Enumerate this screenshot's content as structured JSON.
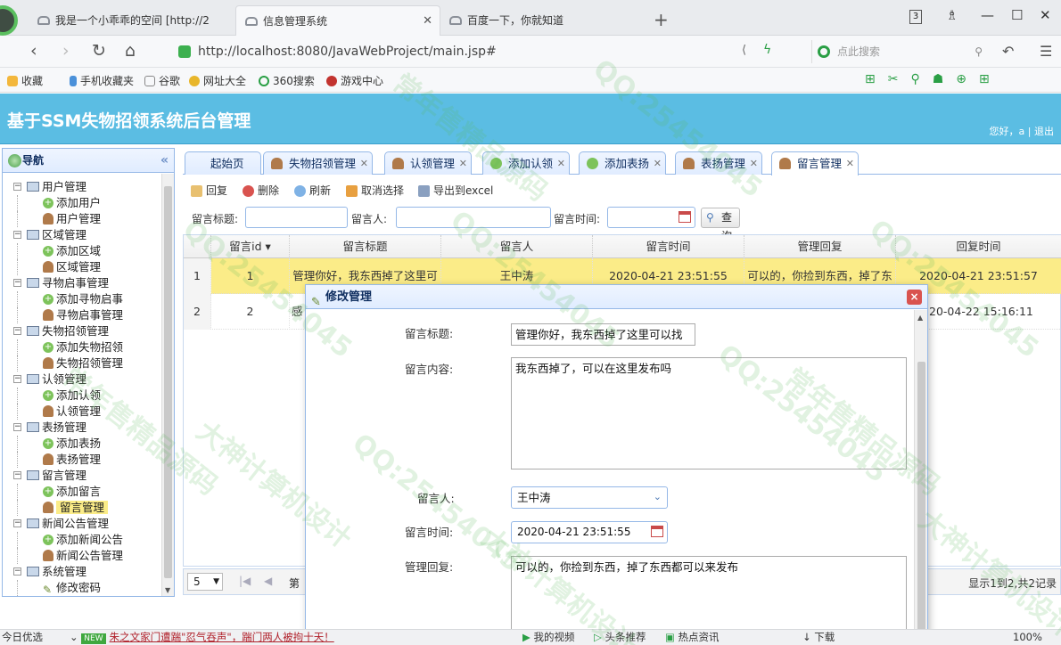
{
  "browser": {
    "tabs": [
      {
        "label": "我是一个小乖乖的空间 [http://2",
        "active": false
      },
      {
        "label": "信息管理系统",
        "active": true
      },
      {
        "label": "百度一下，你就知道",
        "active": false
      }
    ],
    "tab_count": "3",
    "url": "http://localhost:8080/JavaWebProject/main.jsp#",
    "search_placeholder": "点此搜索",
    "bookmarks": [
      "收藏",
      "手机收藏夹",
      "谷歌",
      "网址大全",
      "360搜索",
      "游戏中心"
    ],
    "zoom": "100%"
  },
  "app": {
    "title": "基于SSM失物招领系统后台管理",
    "user_greeting": "您好，a",
    "logout": "退出",
    "separator": "|"
  },
  "nav": {
    "title": "导航",
    "collapse": "«",
    "groups": [
      {
        "label": "用户管理",
        "children": [
          {
            "label": "添加用户",
            "icon": "add-icon"
          },
          {
            "label": "用户管理",
            "icon": "user-icon"
          }
        ]
      },
      {
        "label": "区域管理",
        "children": [
          {
            "label": "添加区域",
            "icon": "add-icon"
          },
          {
            "label": "区域管理",
            "icon": "user-icon"
          }
        ]
      },
      {
        "label": "寻物启事管理",
        "children": [
          {
            "label": "添加寻物启事",
            "icon": "add-icon"
          },
          {
            "label": "寻物启事管理",
            "icon": "user-icon"
          }
        ]
      },
      {
        "label": "失物招领管理",
        "children": [
          {
            "label": "添加失物招领",
            "icon": "add-icon"
          },
          {
            "label": "失物招领管理",
            "icon": "user-icon"
          }
        ]
      },
      {
        "label": "认领管理",
        "children": [
          {
            "label": "添加认领",
            "icon": "add-icon"
          },
          {
            "label": "认领管理",
            "icon": "user-icon"
          }
        ]
      },
      {
        "label": "表扬管理",
        "children": [
          {
            "label": "添加表扬",
            "icon": "add-icon"
          },
          {
            "label": "表扬管理",
            "icon": "user-icon"
          }
        ]
      },
      {
        "label": "留言管理",
        "children": [
          {
            "label": "添加留言",
            "icon": "add-icon"
          },
          {
            "label": "留言管理",
            "icon": "user-icon",
            "selected": true
          }
        ]
      },
      {
        "label": "新闻公告管理",
        "children": [
          {
            "label": "添加新闻公告",
            "icon": "add-icon"
          },
          {
            "label": "新闻公告管理",
            "icon": "user-icon"
          }
        ]
      },
      {
        "label": "系统管理",
        "children": [
          {
            "label": "修改密码",
            "icon": "pencil-icon"
          }
        ]
      }
    ]
  },
  "main_tabs": [
    {
      "label": "起始页",
      "icon": "none"
    },
    {
      "label": "失物招领管理",
      "icon": "user-icon"
    },
    {
      "label": "认领管理",
      "icon": "user-icon"
    },
    {
      "label": "添加认领",
      "icon": "add-icon"
    },
    {
      "label": "添加表扬",
      "icon": "add-icon"
    },
    {
      "label": "表扬管理",
      "icon": "user-icon"
    },
    {
      "label": "留言管理",
      "icon": "user-icon",
      "active": true
    }
  ],
  "toolbar": {
    "reply": "回复",
    "delete": "删除",
    "refresh": "刷新",
    "cancel_select": "取消选择",
    "export": "导出到excel"
  },
  "filter": {
    "title_label": "留言标题:",
    "person_label": "留言人:",
    "time_label": "留言时间:",
    "query": "查询"
  },
  "grid": {
    "columns": [
      "留言id ▾",
      "留言标题",
      "留言人",
      "留言时间",
      "管理回复",
      "回复时间"
    ],
    "rows": [
      {
        "rownum": "1",
        "id": "1",
        "title": "管理你好，我东西掉了这里可",
        "person": "王中涛",
        "time": "2020-04-21 23:51:55",
        "reply": "可以的，你捡到东西，掉了东",
        "reply_time": "2020-04-21 23:51:57"
      },
      {
        "rownum": "2",
        "id": "2",
        "title": "感",
        "person": "",
        "time": "",
        "reply": "",
        "reply_time": "20-04-22 15:16:11"
      }
    ]
  },
  "pager": {
    "page_size": "5",
    "page_label": "第",
    "info": "显示1到2,共2记录"
  },
  "dialog": {
    "title": "修改管理",
    "title_label": "留言标题:",
    "title_value": "管理你好，我东西掉了这里可以找",
    "content_label": "留言内容:",
    "content_value": "我东西掉了，可以在这里发布吗",
    "person_label": "留言人:",
    "person_value": "王中涛",
    "time_label": "留言时间:",
    "time_value": "2020-04-21 23:51:55",
    "reply_label": "管理回复:",
    "reply_value": "可以的，你捡到东西，掉了东西都可以来发布"
  },
  "statusbar": {
    "weather": "今日优选",
    "news_badge": "NEW",
    "news": "朱之文家门遭踹\"忍气吞声\"，踹门两人被拘十天！",
    "items": [
      "我的视频",
      "头条推荐",
      "热点资讯",
      "下载"
    ],
    "zoom": "100%"
  },
  "watermark": {
    "qq": "QQ:25454045",
    "text_a": "常年售精品源码",
    "text_b": "大神计算机设计"
  },
  "colors": {
    "header_bg": "#5bbde3",
    "selected_row": "#fbec88",
    "panel_border": "#95b8e7"
  }
}
